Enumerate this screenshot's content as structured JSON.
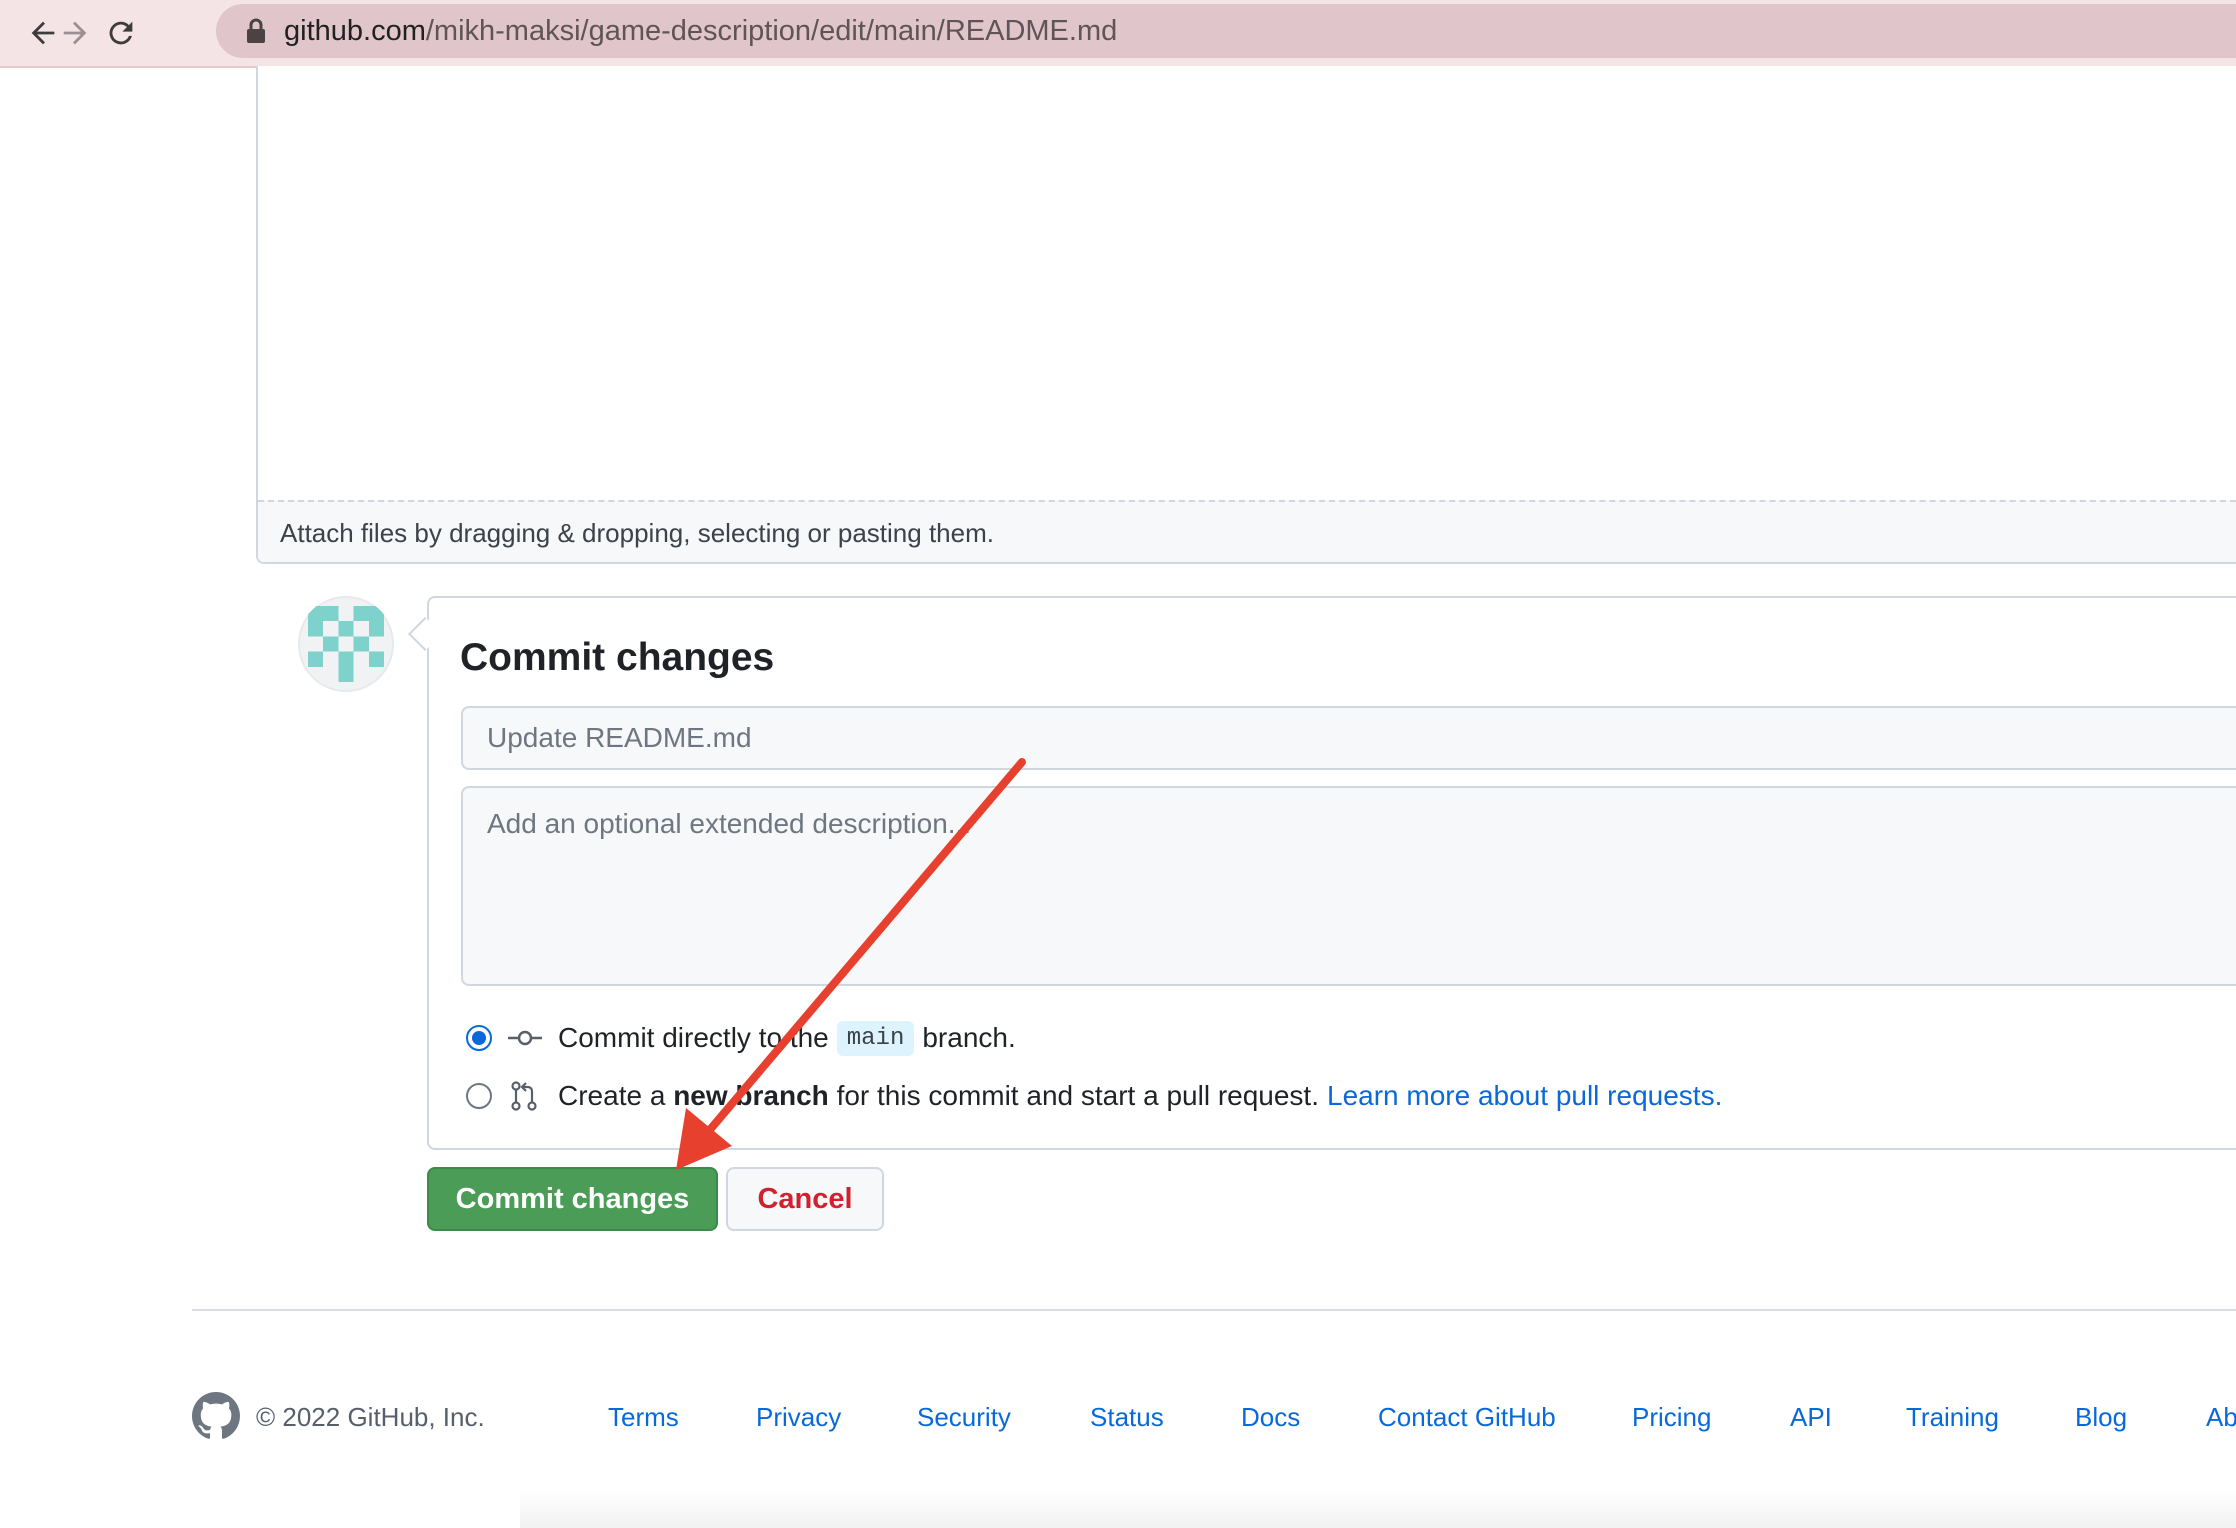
{
  "browser": {
    "url_host": "github.com",
    "url_path": "/mikh-maksi/game-description/edit/main/README.md",
    "icons": [
      "back-icon",
      "forward-icon",
      "reload-icon",
      "lock-icon"
    ]
  },
  "editor": {
    "attach_hint": "Attach files by dragging & dropping, selecting or pasting them."
  },
  "commit": {
    "title": "Commit changes",
    "summary_placeholder": "Update README.md",
    "description_placeholder": "Add an optional extended description...",
    "option_direct": {
      "prefix": "Commit directly to the",
      "branch": "main",
      "suffix": "branch.",
      "selected": true
    },
    "option_new_branch": {
      "prefix": "Create a",
      "bold": "new branch",
      "suffix": "for this commit and start a pull request.",
      "link": "Learn more about pull requests.",
      "selected": false
    },
    "commit_button": "Commit changes",
    "cancel_button": "Cancel"
  },
  "colors": {
    "commit_button": "#4a9c57",
    "cancel_text": "#cf222e",
    "link": "#0969da",
    "annotation_arrow": "#e8402f"
  },
  "footer": {
    "copyright": "© 2022 GitHub, Inc.",
    "links": [
      "Terms",
      "Privacy",
      "Security",
      "Status",
      "Docs",
      "Contact GitHub",
      "Pricing",
      "API",
      "Training",
      "Blog",
      "Ab"
    ]
  }
}
